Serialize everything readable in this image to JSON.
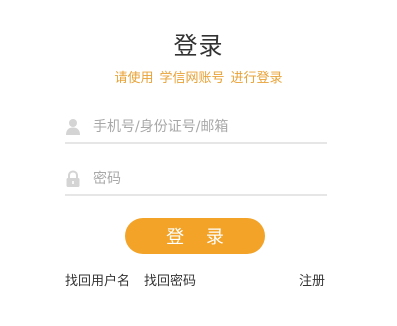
{
  "title": "登录",
  "subtitle": {
    "part1": "请使用",
    "part2": "学信网账号",
    "part3": "进行登录"
  },
  "username_field": {
    "placeholder": "手机号/身份证号/邮箱",
    "value": "",
    "icon": "user-icon"
  },
  "password_field": {
    "placeholder": "密码",
    "value": "",
    "icon": "lock-icon"
  },
  "login_button": {
    "label": "登 录"
  },
  "links": {
    "forgot_username": "找回用户名",
    "forgot_password": "找回密码",
    "register": "注册"
  },
  "colors": {
    "accent": "#f2a328",
    "subtitle": "#e8a236",
    "title": "#333333",
    "placeholder": "#a8a8a8",
    "divider": "#e6e6e6"
  }
}
